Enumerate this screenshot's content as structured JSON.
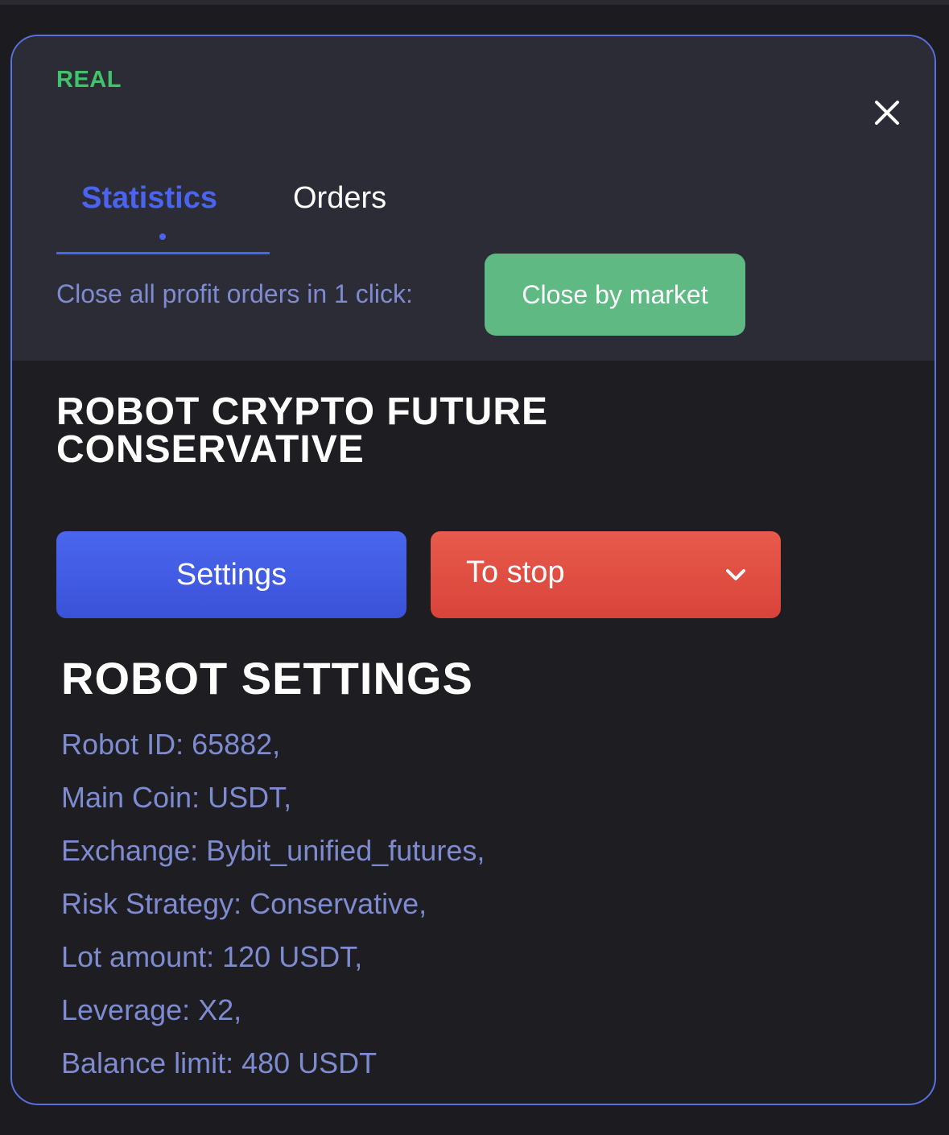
{
  "badge": "REAL",
  "close_icon": "close-icon",
  "tabs": [
    {
      "label": "Statistics",
      "active": true
    },
    {
      "label": "Orders",
      "active": false
    }
  ],
  "close_all": {
    "label": "Close all profit orders in 1 click:",
    "button": "Close by market"
  },
  "robot": {
    "title_line1": "ROBOT CRYPTO FUTURE",
    "title_line2": "CONSERVATIVE"
  },
  "actions": {
    "settings_label": "Settings",
    "stop_label": "To stop",
    "stop_icon": "chevron-down-icon"
  },
  "robot_settings": {
    "title": "ROBOT SETTINGS",
    "items": [
      "Robot ID: 65882,",
      "Main Coin: USDT,",
      "Exchange: Bybit_unified_futures,",
      "Risk Strategy: Conservative,",
      "Lot amount: 120 USDT,",
      "Leverage: X2,",
      "Balance limit: 480 USDT"
    ]
  },
  "colors": {
    "accent_blue": "#4a64f0",
    "real_green": "#3fc46c",
    "market_green": "#5eb983",
    "stop_red": "#e04c40",
    "muted_text": "#7f8bd0"
  }
}
